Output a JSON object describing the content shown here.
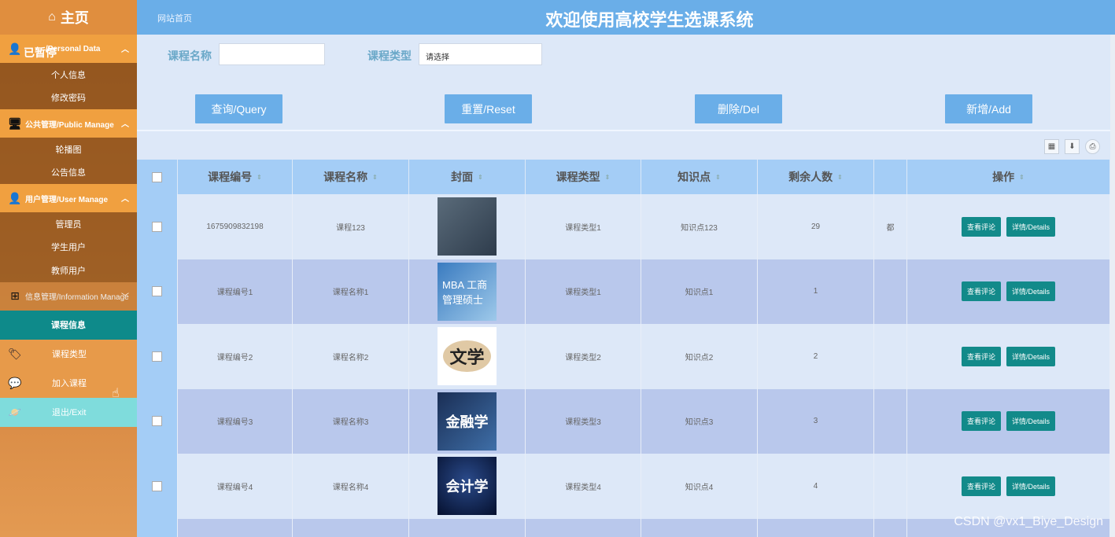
{
  "sidebar": {
    "home": "主页",
    "paused": "已暂停",
    "groups": [
      {
        "label": "/Personal Data",
        "items": [
          "个人信息",
          "修改密码"
        ]
      },
      {
        "label": "公共管理/Public Manage",
        "items": [
          "轮播图",
          "公告信息"
        ]
      },
      {
        "label": "用户管理/User Manage",
        "items": [
          "管理员",
          "学生用户",
          "教师用户"
        ]
      },
      {
        "label": "信息管理/Information Manage",
        "items": []
      }
    ],
    "active_item": "课程信息",
    "plain_items": [
      "课程类型",
      "加入课程",
      "退出/Exit"
    ]
  },
  "header": {
    "breadcrumb": "网站首页",
    "title": "欢迎使用高校学生选课系统"
  },
  "search": {
    "name_label": "课程名称",
    "name_value": "",
    "type_label": "课程类型",
    "type_placeholder": "请选择"
  },
  "buttons": {
    "query": "查询/Query",
    "reset": "重置/Reset",
    "delete": "删除/Del",
    "add": "新增/Add"
  },
  "table": {
    "headers": [
      "课程编号",
      "课程名称",
      "封面",
      "课程类型",
      "知识点",
      "剩余人数",
      "",
      "操作"
    ],
    "rows": [
      {
        "id": "1675909832198",
        "name": "课程123",
        "cover": "",
        "type": "课程类型1",
        "point": "知识点123",
        "remain": "29",
        "extra": "都"
      },
      {
        "id": "课程编号1",
        "name": "课程名称1",
        "cover": "MBA 工商管理硕士",
        "type": "课程类型1",
        "point": "知识点1",
        "remain": "1",
        "extra": ""
      },
      {
        "id": "课程编号2",
        "name": "课程名称2",
        "cover": "文学",
        "type": "课程类型2",
        "point": "知识点2",
        "remain": "2",
        "extra": ""
      },
      {
        "id": "课程编号3",
        "name": "课程名称3",
        "cover": "金融学",
        "type": "课程类型3",
        "point": "知识点3",
        "remain": "3",
        "extra": ""
      },
      {
        "id": "课程编号4",
        "name": "课程名称4",
        "cover": "会计学",
        "type": "课程类型4",
        "point": "知识点4",
        "remain": "4",
        "extra": ""
      }
    ],
    "actions": {
      "review": "查看评论",
      "details": "详情/Details"
    }
  },
  "watermark": "CSDN @vx1_Biye_Design",
  "colors": {
    "topbar": "#6aaee8",
    "sidebar_group": "#f0a040",
    "active": "#0e8a8a",
    "action_button": "#128a8a"
  }
}
